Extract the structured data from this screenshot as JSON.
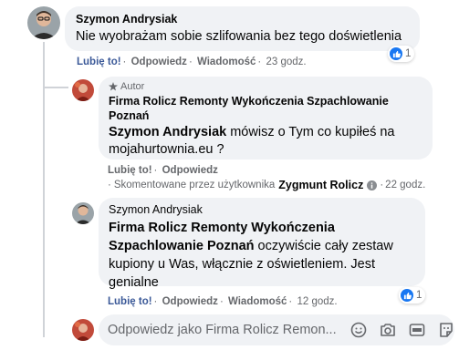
{
  "comments": [
    {
      "author": "Szymon Andrysiak",
      "text": "Nie wyobrażam sobie szlifowania bez tego doświetlenia",
      "actions": {
        "like": "Lubię to!",
        "reply": "Odpowiedz",
        "message": "Wiadomość",
        "time": "23 godz."
      },
      "reaction_count": "1"
    },
    {
      "badge": "Autor",
      "author": "Firma Rolicz Remonty Wykończenia Szpachlowanie Poznań",
      "tag": "Szymon Andrysiak",
      "text": " mówisz o Tym co kupiłeś na mojahurtownia.eu ?",
      "actions": {
        "like": "Lubię to!",
        "reply": "Odpowiedz"
      },
      "commented_by_prefix": "Skomentowane przez użytkownika",
      "commented_by_name": "Zygmunt Rolicz",
      "time": "22 godz."
    },
    {
      "author": "Szymon Andrysiak",
      "tag": "Firma Rolicz Remonty Wykończenia Szpachlowanie Poznań",
      "text": " oczywiście cały zestaw kupiony u Was, włącznie z oświetleniem. Jest genialne",
      "actions": {
        "like": "Lubię to!",
        "reply": "Odpowiedz",
        "message": "Wiadomość",
        "time": "12 godz."
      },
      "reaction_count": "1"
    }
  ],
  "reply_box": {
    "placeholder": "Odpowiedz jako Firma Rolicz Remon..."
  },
  "icons": [
    "emoji-icon",
    "camera-icon",
    "gif-icon",
    "sticker-icon"
  ],
  "colors": {
    "like_blue": "#1877f2",
    "accent_link": "#3b5998",
    "bubble": "#f0f2f5"
  }
}
